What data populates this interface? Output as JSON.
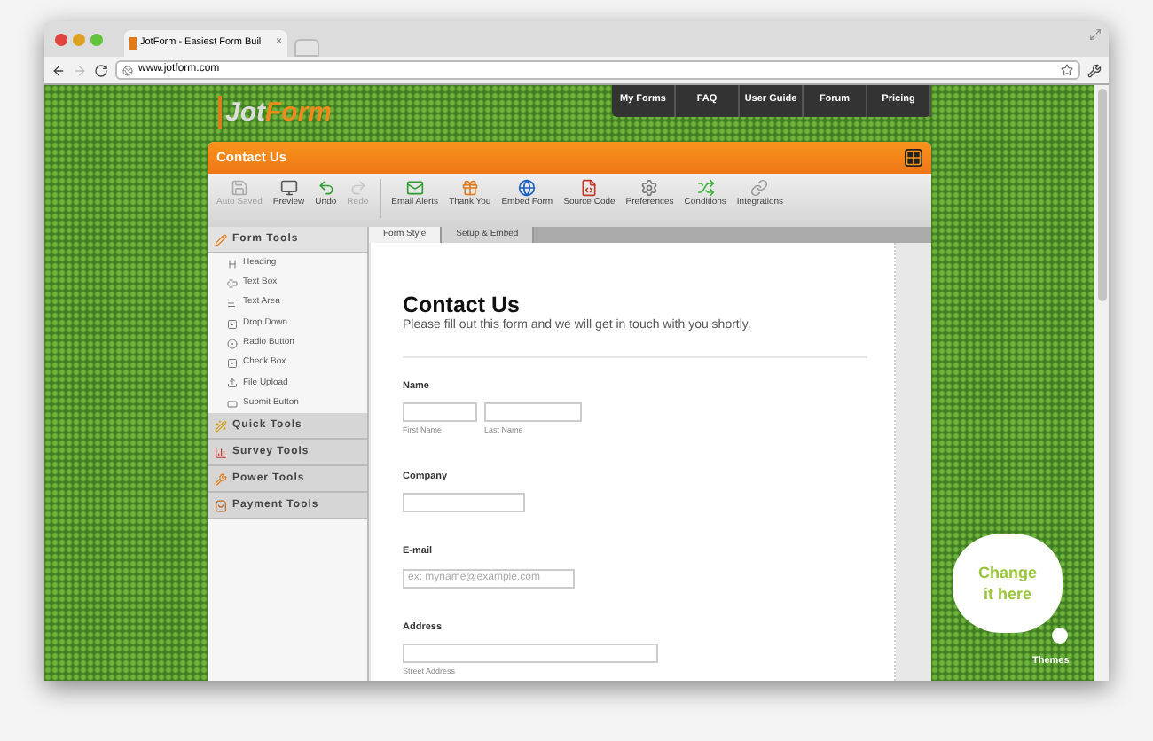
{
  "browser": {
    "tab_title": "JotForm - Easiest Form Buil",
    "tab_close": "×",
    "address": "www.jotform.com"
  },
  "site": {
    "logo": [
      "Jot",
      "Form"
    ],
    "nav": [
      "My Forms",
      "FAQ",
      "User Guide",
      "Forum",
      "Pricing"
    ]
  },
  "builder": {
    "title": "Contact Us",
    "toolbar": [
      {
        "label": "Auto Saved",
        "disabled": true
      },
      {
        "label": "Preview",
        "disabled": false
      },
      {
        "label": "Undo",
        "disabled": false
      },
      {
        "label": "Redo",
        "disabled": true
      },
      {
        "label": "Email Alerts",
        "disabled": false
      },
      {
        "label": "Thank You",
        "disabled": false
      },
      {
        "label": "Embed Form",
        "disabled": false
      },
      {
        "label": "Source Code",
        "disabled": false
      },
      {
        "label": "Preferences",
        "disabled": false
      },
      {
        "label": "Conditions",
        "disabled": false
      },
      {
        "label": "Integrations",
        "disabled": false
      }
    ],
    "sidebar": [
      {
        "label": "Form Tools",
        "expanded": true,
        "items": [
          "Heading",
          "Text Box",
          "Text Area",
          "Drop Down",
          "Radio Button",
          "Check Box",
          "File Upload",
          "Submit Button"
        ]
      },
      {
        "label": "Quick Tools",
        "expanded": false
      },
      {
        "label": "Survey Tools",
        "expanded": false
      },
      {
        "label": "Power Tools",
        "expanded": false
      },
      {
        "label": "Payment Tools",
        "expanded": false
      }
    ],
    "tabs": [
      {
        "label": "Form Style",
        "selected": true
      },
      {
        "label": "Setup & Embed",
        "selected": false
      }
    ],
    "form": {
      "title": "Contact Us",
      "subtitle": "Please fill out this form and we will get in touch with you shortly.",
      "fields": [
        {
          "label": "Name",
          "kind": "split",
          "sublabels": [
            "First Name",
            "Last Name"
          ]
        },
        {
          "label": "Company",
          "kind": "single"
        },
        {
          "label": "E-mail",
          "kind": "email",
          "placeholder": "ex: myname@example.com"
        },
        {
          "label": "Address",
          "kind": "wide",
          "sublabels": [
            "Street Address"
          ]
        }
      ]
    }
  },
  "bubble": {
    "text": "Change it here",
    "themes": "Themes"
  }
}
